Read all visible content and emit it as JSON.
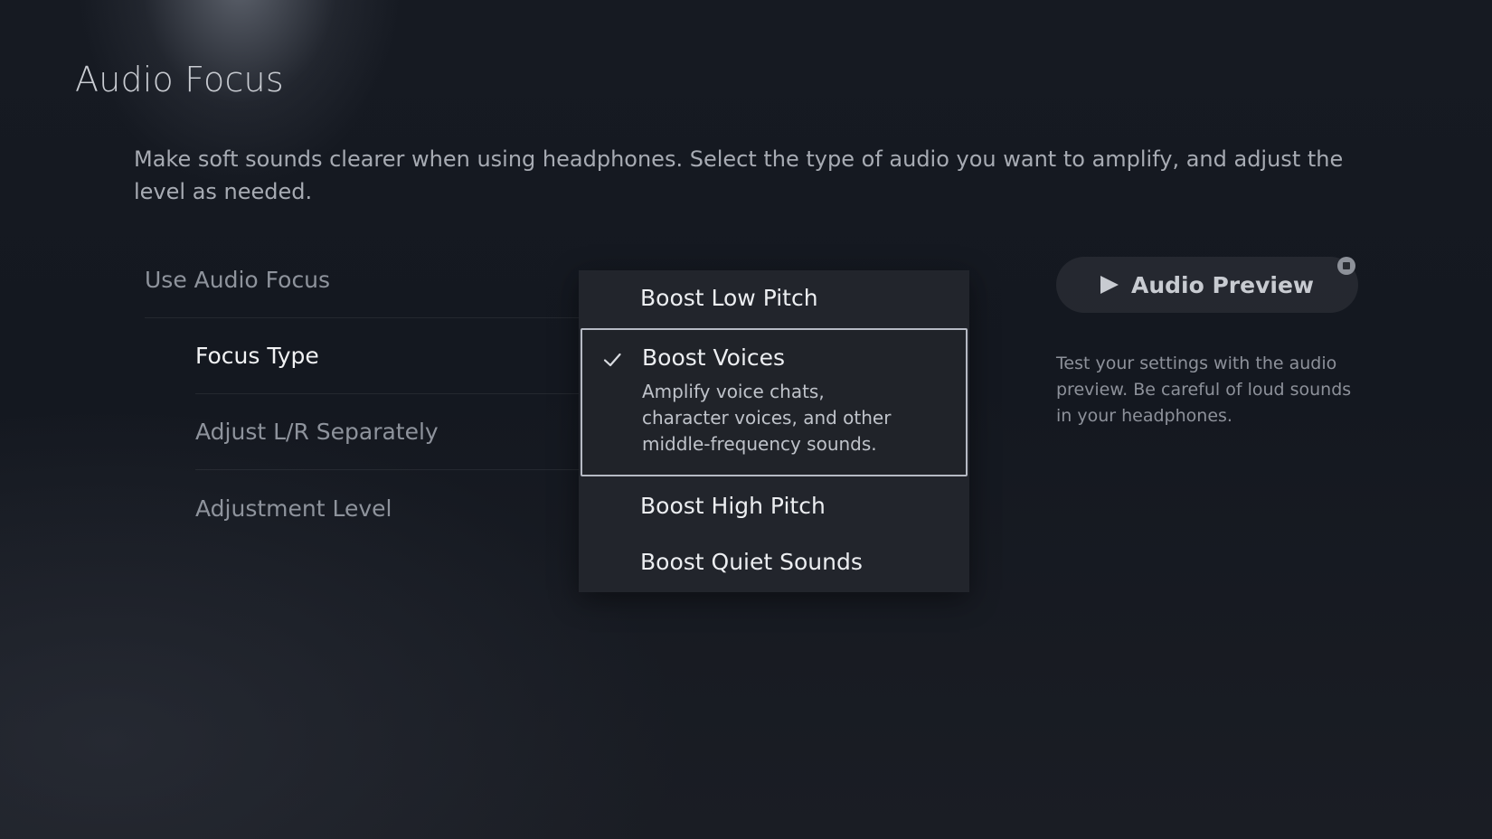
{
  "page": {
    "title": "Audio Focus",
    "description": "Make soft sounds clearer when using headphones. Select the type of audio you want to amplify, and adjust the level as needed."
  },
  "settings": {
    "items": [
      {
        "label": "Use Audio Focus"
      },
      {
        "label": "Focus Type"
      },
      {
        "label": "Adjust L/R Separately"
      },
      {
        "label": "Adjustment Level"
      }
    ]
  },
  "dropdown": {
    "options": [
      {
        "label": "Boost Low Pitch"
      },
      {
        "label": "Boost Voices",
        "description": "Amplify voice chats, character voices, and other middle-frequency sounds.",
        "selected": true
      },
      {
        "label": "Boost High Pitch"
      },
      {
        "label": "Boost Quiet Sounds"
      }
    ],
    "check_icon": "checkmark-icon"
  },
  "preview": {
    "button_label": "Audio Preview",
    "play_icon": "play-icon",
    "stop_icon": "stop-icon",
    "description": "Test your settings with the audio preview. Be careful of loud sounds in your headphones."
  },
  "colors": {
    "background": "#141820",
    "dropdown_bg": "#22252c",
    "selected_border": "#b6bac4",
    "text_active": "#f1f2f4",
    "text_inactive": "#8e939c"
  }
}
